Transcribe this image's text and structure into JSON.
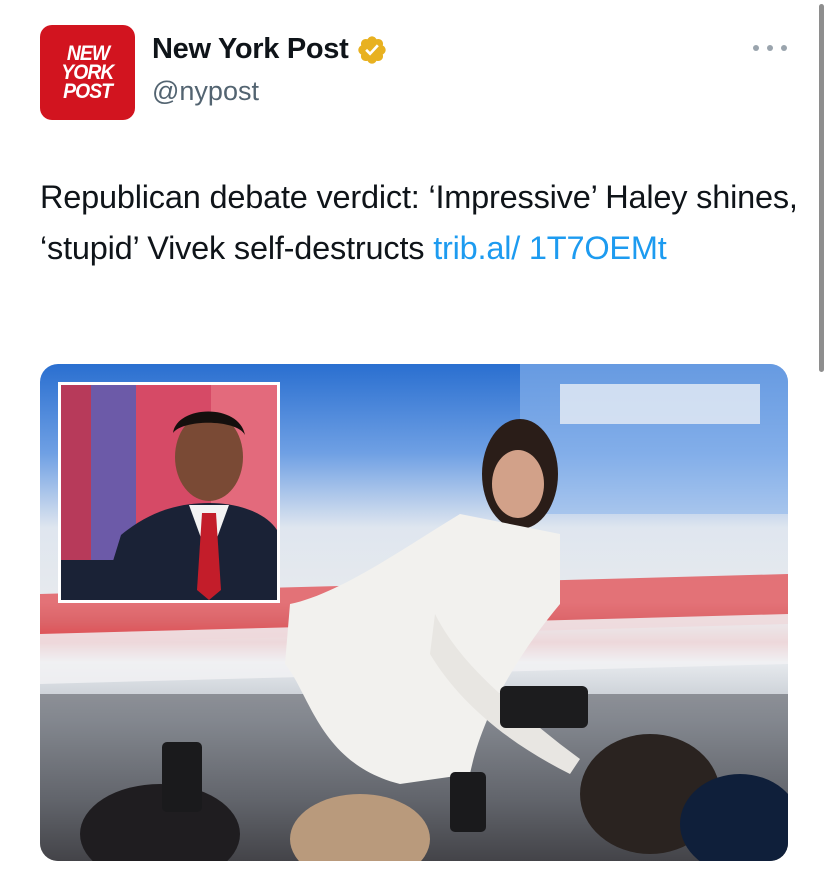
{
  "author": {
    "avatar_text": [
      "NEW",
      "YORK",
      "POST"
    ],
    "display_name": "New York Post",
    "handle": "@nypost",
    "verified_badge_color": "#e8b120",
    "avatar_color": "#d2141f"
  },
  "tweet": {
    "text": "Republican debate verdict: ‘Impressive’ Haley shines, ‘stupid’ Vivek self-destructs ",
    "link_text": "trib.al/ 1T7OEMt",
    "link_color": "#1d9bf0"
  },
  "media": {
    "photo_icon": "photo-image",
    "inset_photo_icon": "inset-photo-image"
  },
  "icons": {
    "more": "more-options-icon",
    "verified": "verified-badge-icon"
  }
}
